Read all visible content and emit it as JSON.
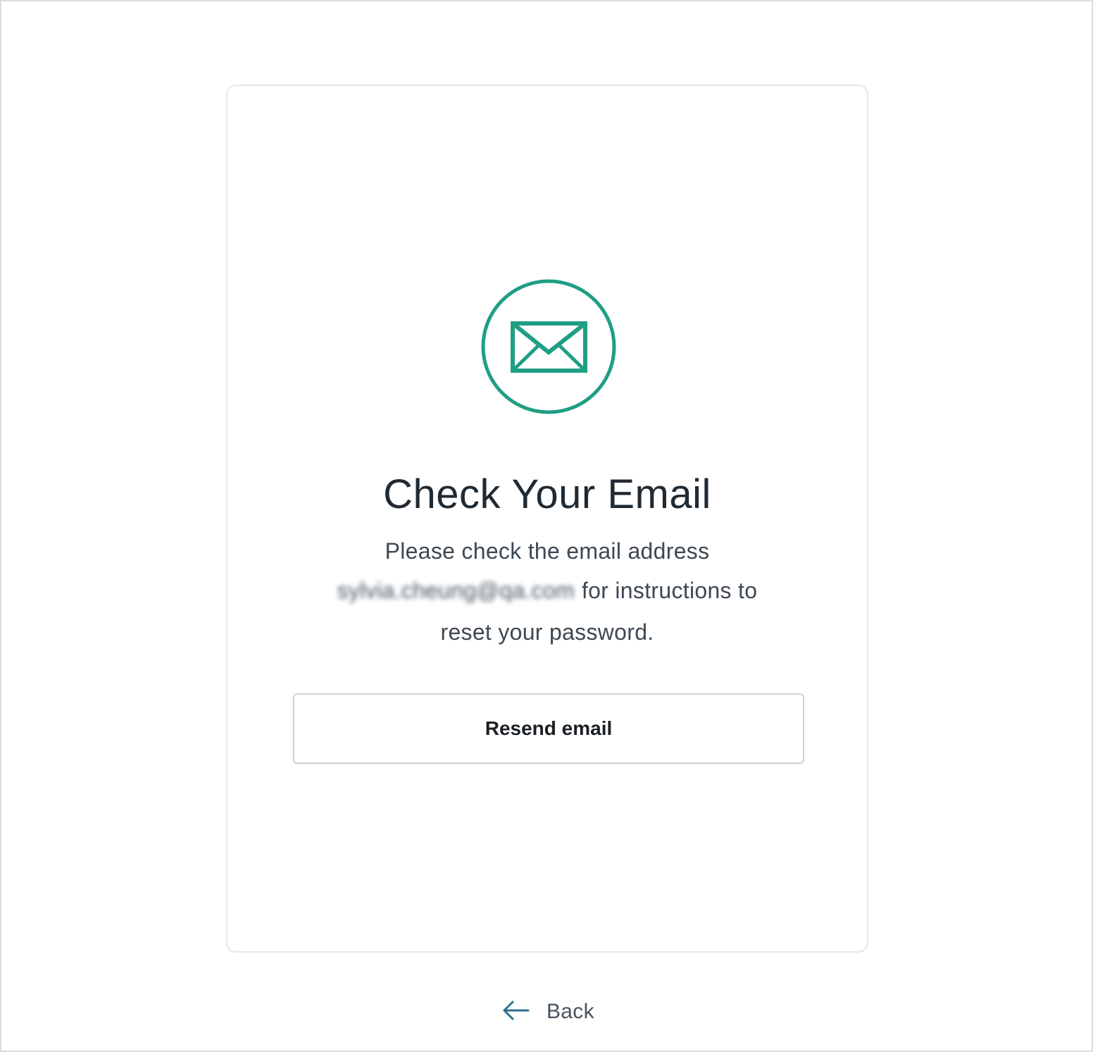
{
  "card": {
    "icon": "envelope-icon",
    "title": "Check Your Email",
    "message_line1": "Please check the email address",
    "email": "sylvia.cheung@qa.com",
    "message_line2_suffix": "for instructions to",
    "message_line3": "reset your password.",
    "resend_label": "Resend email"
  },
  "footer": {
    "back_icon": "arrow-left-icon",
    "back_label": "Back"
  },
  "colors": {
    "accent": "#1f9e84",
    "text_dark": "#1f2a33",
    "text_body": "#3e4852",
    "back_arrow": "#2e6f8e"
  }
}
